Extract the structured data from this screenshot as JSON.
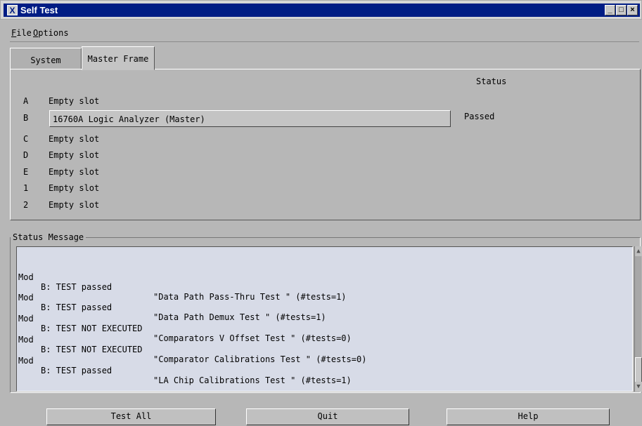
{
  "window": {
    "title": "Self Test",
    "icon_letter": "X"
  },
  "menu": {
    "file": {
      "accel": "F",
      "rest": "ile"
    },
    "options": {
      "accel": "O",
      "rest": "ptions"
    }
  },
  "tabs": [
    {
      "label": "System",
      "active": false
    },
    {
      "label": "Master Frame",
      "active": true
    }
  ],
  "slots": {
    "status_header": "Status",
    "rows": [
      {
        "letter": "A",
        "name": "Empty slot",
        "status": ""
      },
      {
        "letter": "B",
        "name": "16760A Logic Analyzer (Master)",
        "status": "Passed"
      },
      {
        "letter": "C",
        "name": "Empty slot",
        "status": ""
      },
      {
        "letter": "D",
        "name": "Empty slot",
        "status": ""
      },
      {
        "letter": "E",
        "name": "Empty slot",
        "status": ""
      },
      {
        "letter": "1",
        "name": "Empty slot",
        "status": ""
      },
      {
        "letter": "2",
        "name": "Empty slot",
        "status": ""
      }
    ]
  },
  "status_message": {
    "label": "Status Message",
    "lines": [
      {
        "mod": "Mod",
        "result": "B: TEST passed",
        "test": "\"Data Path Pass-Thru Test \" (#tests=1)"
      },
      {
        "mod": "Mod",
        "result": "B: TEST passed",
        "test": "\"Data Path Demux Test \" (#tests=1)"
      },
      {
        "mod": "Mod",
        "result": "B: TEST NOT EXECUTED",
        "test": "\"Comparators V Offset Test \" (#tests=0)"
      },
      {
        "mod": "Mod",
        "result": "B: TEST NOT EXECUTED",
        "test": "\"Comparator Calibrations Test \" (#tests=0)"
      },
      {
        "mod": "Mod",
        "result": "B: TEST passed",
        "test": "\"LA Chip Calibrations Test \" (#tests=1)"
      }
    ]
  },
  "buttons": {
    "test_all": "Test All",
    "quit": "Quit",
    "help": "Help"
  },
  "colors": {
    "titlebar": "#001c84",
    "background": "#b7b7b7",
    "message_area": "#d7dbe7"
  }
}
